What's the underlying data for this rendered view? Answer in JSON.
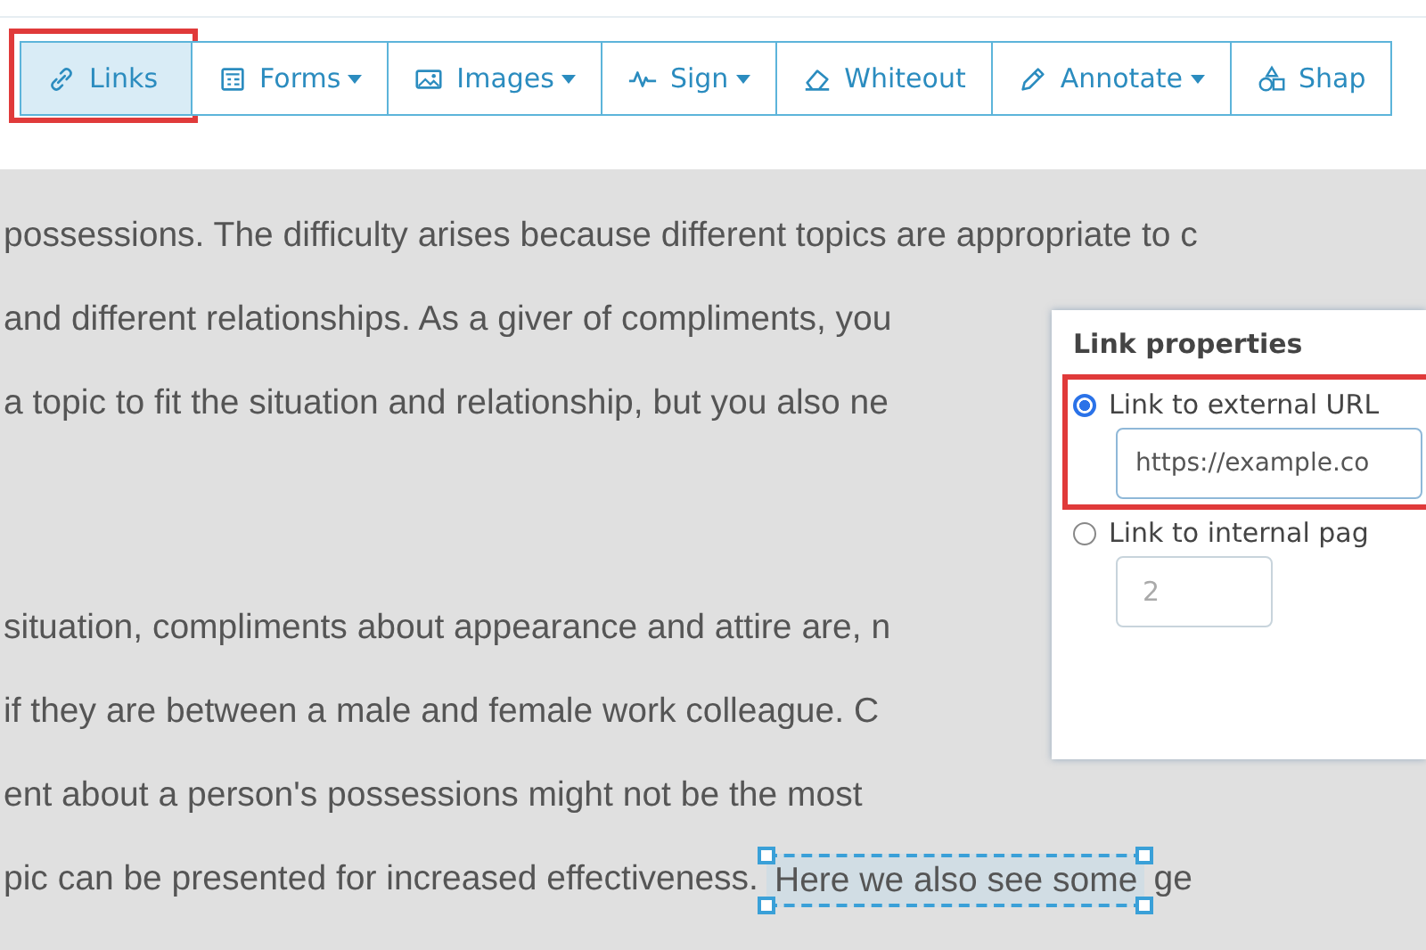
{
  "toolbar": {
    "buttons": [
      {
        "label": "Links",
        "kind": "link",
        "selected": true,
        "dropdown": false,
        "highlighted": true
      },
      {
        "label": "Forms",
        "kind": "form",
        "selected": false,
        "dropdown": true,
        "highlighted": false
      },
      {
        "label": "Images",
        "kind": "image",
        "selected": false,
        "dropdown": true,
        "highlighted": false
      },
      {
        "label": "Sign",
        "kind": "sign",
        "selected": false,
        "dropdown": true,
        "highlighted": false
      },
      {
        "label": "Whiteout",
        "kind": "eraser",
        "selected": false,
        "dropdown": false,
        "highlighted": false
      },
      {
        "label": "Annotate",
        "kind": "pen",
        "selected": false,
        "dropdown": true,
        "highlighted": false
      },
      {
        "label": "Shap",
        "kind": "shapes",
        "selected": false,
        "dropdown": false,
        "highlighted": false
      }
    ]
  },
  "document": {
    "paragraphs": [
      {
        "lines": [
          {
            "text": "possessions. The difficulty arises because different topics are appropriate to c"
          },
          {
            "text": "and different relationships. As a giver of compliments, you"
          },
          {
            "text": "a topic to fit the situation and relationship, but you also ne"
          }
        ]
      },
      {
        "lines": [
          {
            "text": "situation, compliments about appearance and attire are, n"
          },
          {
            "text": "if they are between a male and female work colleague. C"
          },
          {
            "text": "ent about a person's possessions might not be the most"
          },
          {
            "text": "pic can be presented for increased effectiveness.",
            "selected_text": "Here we also see some",
            "text_after": "ge"
          }
        ]
      }
    ]
  },
  "link_properties": {
    "title": "Link properties",
    "options": [
      {
        "label": "Link to external URL",
        "selected": true,
        "highlighted": true,
        "value": "https://example.co"
      },
      {
        "label": "Link to internal pag",
        "selected": false,
        "highlighted": false,
        "placeholder": "2"
      }
    ]
  }
}
